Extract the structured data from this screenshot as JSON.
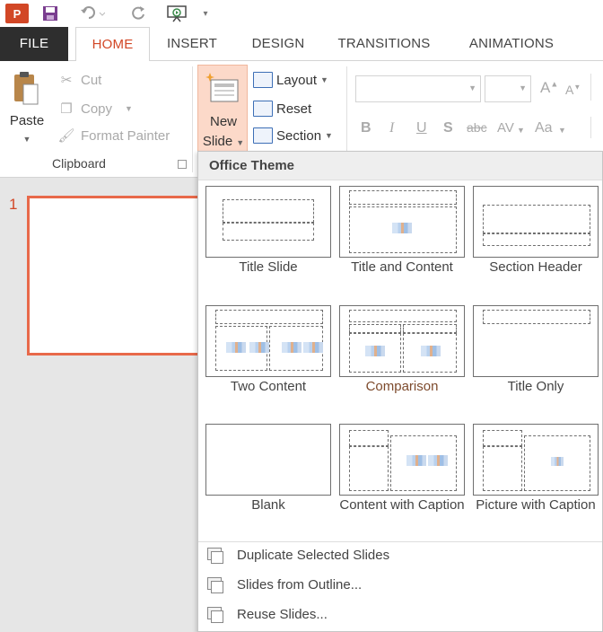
{
  "app": {
    "logo_text": "P"
  },
  "tabs": [
    "FILE",
    "HOME",
    "INSERT",
    "DESIGN",
    "TRANSITIONS",
    "ANIMATIONS"
  ],
  "clipboard": {
    "paste_label": "Paste",
    "cut_label": "Cut",
    "copy_label": "Copy",
    "format_painter_label": "Format Painter",
    "group_label": "Clipboard"
  },
  "slides_group": {
    "new_slide_line1": "New",
    "new_slide_line2": "Slide",
    "layout_label": "Layout",
    "reset_label": "Reset",
    "section_label": "Section"
  },
  "font_group": {
    "grow_font": "A",
    "shrink_font": "A",
    "bold": "B",
    "italic": "I",
    "underline": "U",
    "shadow": "S",
    "strikethrough": "abc",
    "spacing": "AV",
    "change_case": "Aa"
  },
  "slide_pane": {
    "slide_number": "1"
  },
  "gallery": {
    "header": "Office Theme",
    "layouts": [
      {
        "name": "Title Slide"
      },
      {
        "name": "Title and Content"
      },
      {
        "name": "Section Header"
      },
      {
        "name": "Two Content"
      },
      {
        "name": "Comparison"
      },
      {
        "name": "Title Only"
      },
      {
        "name": "Blank"
      },
      {
        "name": "Content with Caption"
      },
      {
        "name": "Picture with Caption"
      }
    ],
    "menu": {
      "duplicate": "Duplicate Selected Slides",
      "outline": "Slides from Outline...",
      "reuse": "Reuse Slides..."
    }
  },
  "colors": {
    "accent": "#d24726",
    "new_slide_highlight": "#fcd9c9",
    "slide_border": "#e8694a"
  }
}
